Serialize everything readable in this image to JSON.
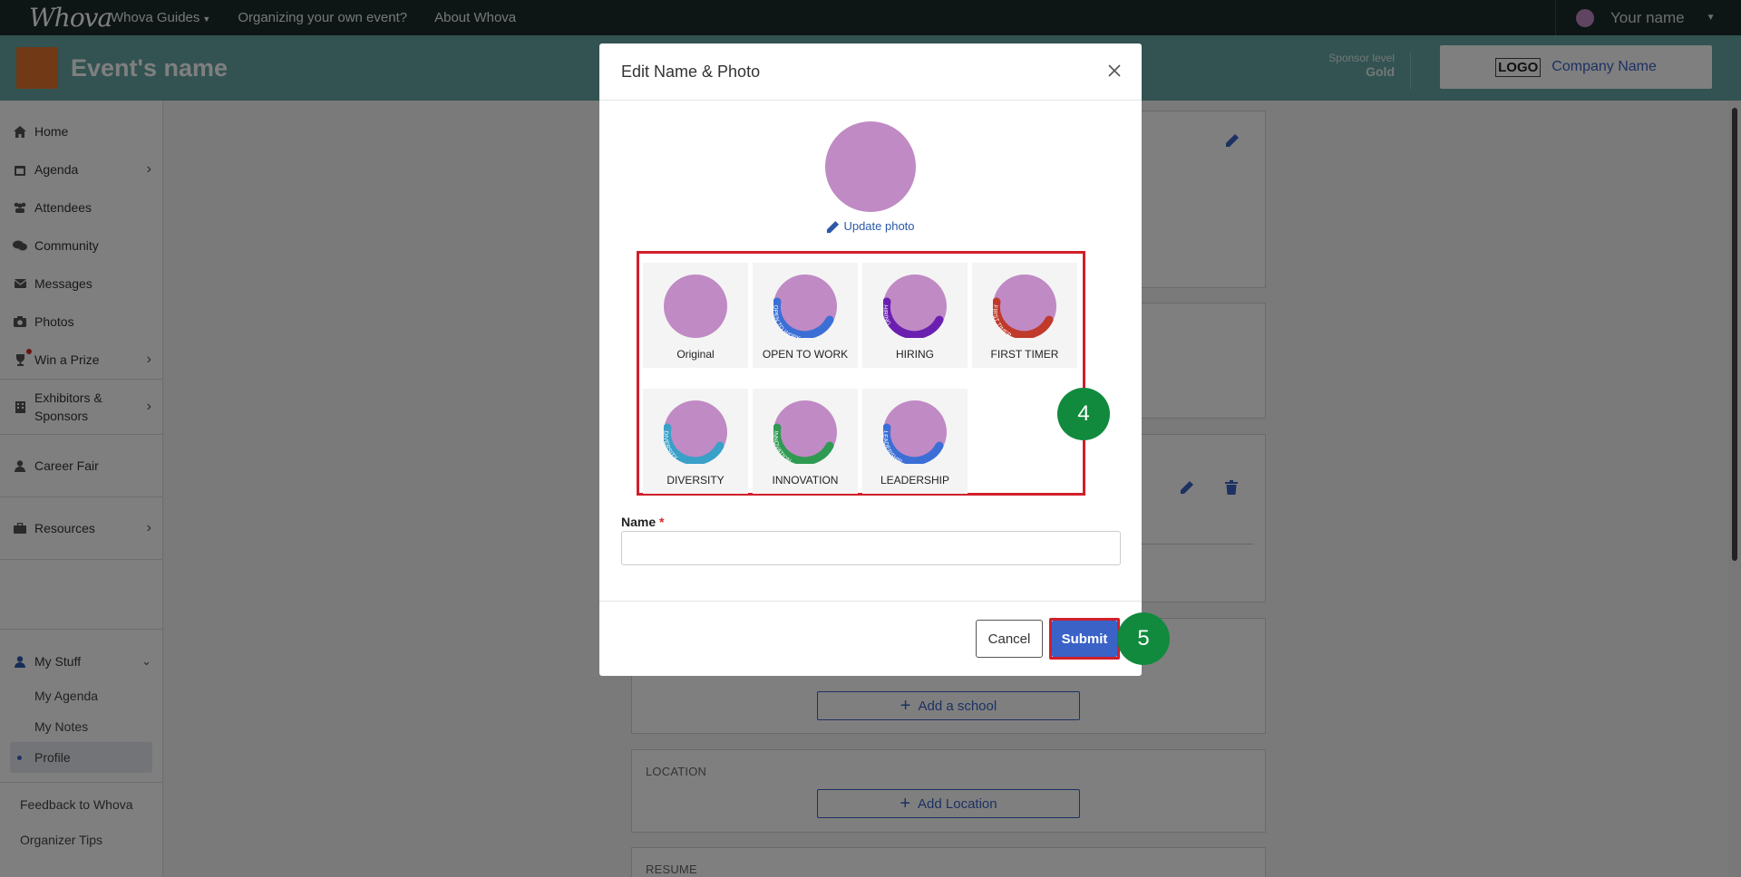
{
  "topnav": {
    "logo": "Whova",
    "links": [
      "Whova Guides",
      "Organizing your own event?",
      "About Whova"
    ],
    "user_name": "Your name"
  },
  "event": {
    "name": "Event's name",
    "sponsor_label": "Sponsor level",
    "sponsor_value": "Gold",
    "logo_text": "LOGO",
    "company_name": "Company Name"
  },
  "sidebar": {
    "items": [
      {
        "label": "Home",
        "icon": "home-icon"
      },
      {
        "label": "Agenda",
        "icon": "calendar-icon"
      },
      {
        "label": "Attendees",
        "icon": "people-icon"
      },
      {
        "label": "Community",
        "icon": "chat-icon"
      },
      {
        "label": "Messages",
        "icon": "envelope-icon"
      },
      {
        "label": "Photos",
        "icon": "camera-icon"
      },
      {
        "label": "Win a Prize",
        "icon": "trophy-icon"
      },
      {
        "label": "Exhibitors & Sponsors",
        "icon": "building-icon"
      },
      {
        "label": "Career Fair",
        "icon": "person-icon"
      },
      {
        "label": "Resources",
        "icon": "briefcase-icon"
      },
      {
        "label": "My Stuff",
        "icon": "user-icon"
      }
    ],
    "sub_items": [
      "My Agenda",
      "My Notes",
      "Profile"
    ],
    "footer_links": [
      "Feedback to Whova",
      "Organizer Tips"
    ]
  },
  "main": {
    "add_school": "Add a school",
    "location_label": "LOCATION",
    "add_location": "Add Location",
    "resume_label": "RESUME"
  },
  "modal": {
    "title": "Edit Name & Photo",
    "update_photo": "Update photo",
    "frames": [
      {
        "label": "Original",
        "ring": ""
      },
      {
        "label": "OPEN TO WORK",
        "ring": "#3b6fd6",
        "ring_text": "OPEN TO WORK"
      },
      {
        "label": "HIRING",
        "ring": "#6a1fb0",
        "ring_text": "HIRING"
      },
      {
        "label": "FIRST TIMER",
        "ring": "#c0392b",
        "ring_text": "FIRST TIMER"
      },
      {
        "label": "DIVERSITY",
        "ring": "#3aa0c8",
        "ring_text": "DIVERSITY"
      },
      {
        "label": "INNOVATION",
        "ring": "#2f9a52",
        "ring_text": "INNOVATION"
      },
      {
        "label": "LEADERSHIP",
        "ring": "#3b6fd6",
        "ring_text": "LEADERSHIP"
      }
    ],
    "name_label": "Name",
    "name_required": "*",
    "name_value": "",
    "cancel": "Cancel",
    "submit": "Submit"
  },
  "badges": {
    "step_frames": "4",
    "step_submit": "5"
  },
  "colors": {
    "avatar": "#c08ac4",
    "accent": "#3a62c7",
    "highlight": "#d11f2a",
    "badge": "#118a3d",
    "eventbar": "#65a7a2"
  }
}
